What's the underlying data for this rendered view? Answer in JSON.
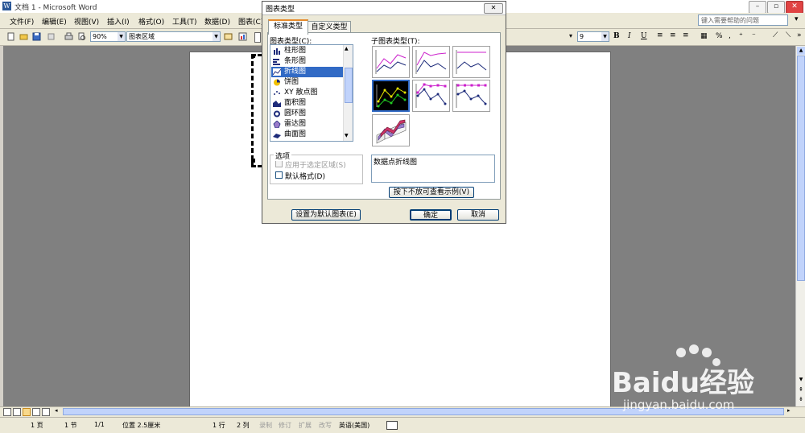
{
  "window": {
    "title": "文档 1 - Microsoft Word"
  },
  "menu": {
    "items": [
      "文件(F)",
      "编辑(E)",
      "视图(V)",
      "插入(I)",
      "格式(O)",
      "工具(T)",
      "数据(D)",
      "图表(C)"
    ],
    "help_placeholder": "键入需要帮助的问题"
  },
  "toolbar": {
    "zoom": "90%",
    "chart_area": "图表区域",
    "font_size": "9"
  },
  "dialog": {
    "title": "图表类型",
    "tabs": [
      "标准类型",
      "自定义类型"
    ],
    "chart_type_label": "图表类型(C):",
    "subtype_label": "子图表类型(T):",
    "chart_types": [
      "柱形图",
      "条形图",
      "折线图",
      "饼图",
      "XY 散点图",
      "面积图",
      "圆环图",
      "雷达图",
      "曲面图"
    ],
    "selected_type": "折线图",
    "options_label": "选项",
    "apply_selection_label": "应用于选定区域(S)",
    "default_format_label": "默认格式(D)",
    "description": "数据点折线图",
    "preview_button": "按下不放可查看示例(V)",
    "set_default_button": "设置为默认图表(E)",
    "ok_button": "确定",
    "cancel_button": "取消"
  },
  "status": {
    "page": "1 页",
    "section": "1 节",
    "page_of": "1/1",
    "position": "位置 2.5厘米",
    "line": "1 行",
    "column": "2 列",
    "rec": "录制",
    "trk": "修订",
    "ext": "扩展",
    "ovr": "改写",
    "language": "英语(美国)"
  },
  "watermark": {
    "brand": "Baidu经验",
    "url": "jingyan.baidu.com"
  },
  "colors": {
    "selection": "#316ac5",
    "doc_background": "#808080",
    "title_accent": "#e68b2c"
  }
}
